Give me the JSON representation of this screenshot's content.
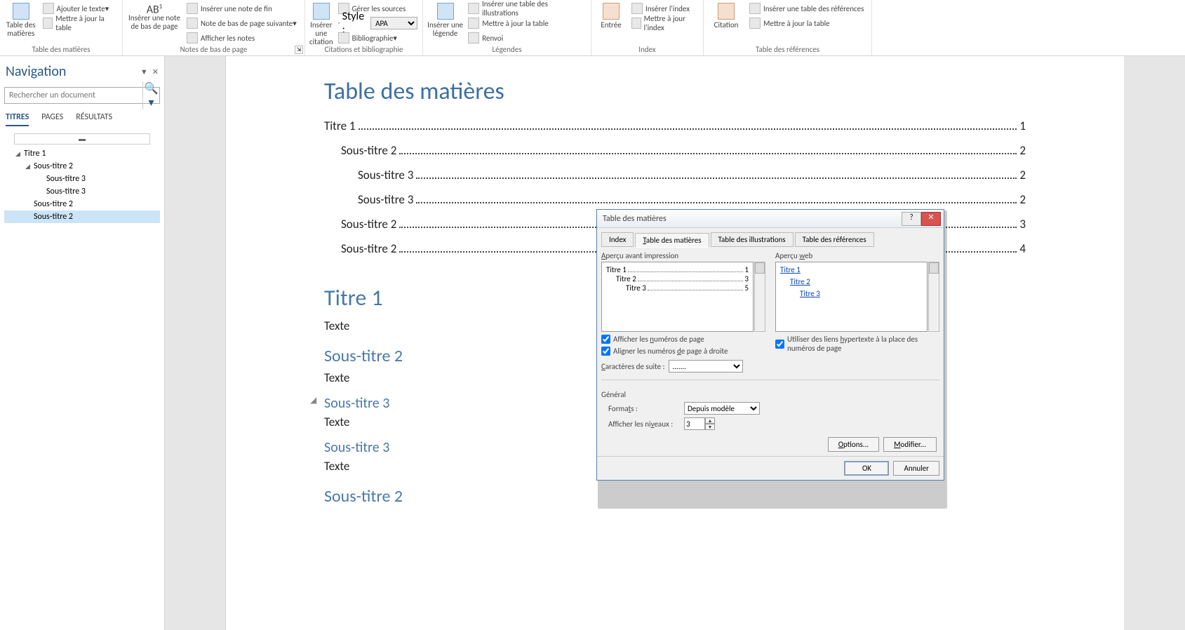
{
  "ribbon": {
    "toc": {
      "label": "Table des matières",
      "main": "Table des matières",
      "add_text": "Ajouter le texte",
      "update": "Mettre à jour la table"
    },
    "footnotes": {
      "label": "Notes de bas de page",
      "main": "Insérer une note de bas de page",
      "ab": "AB",
      "endnote": "Insérer une note de fin",
      "next": "Note de bas de page suivante",
      "show": "Afficher les notes"
    },
    "citations": {
      "label": "Citations et bibliographie",
      "main": "Insérer une citation",
      "manage": "Gérer les sources",
      "style_label": "Style :",
      "style_value": "APA",
      "biblio": "Bibliographie"
    },
    "captions": {
      "label": "Légendes",
      "main": "Insérer une légende",
      "insert_table": "Insérer une table des illustrations",
      "update": "Mettre à jour la table",
      "crossref": "Renvoi"
    },
    "index": {
      "label": "Index",
      "main": "Entrée",
      "insert": "Insérer l'index",
      "update": "Mettre à jour l'index"
    },
    "refs_table": {
      "label": "Table des références",
      "main": "Citation",
      "insert": "Insérer une table des références",
      "update": "Mettre à jour la table"
    }
  },
  "nav": {
    "title": "Navigation",
    "search_placeholder": "Rechercher un document",
    "tabs": [
      "TITRES",
      "PAGES",
      "RÉSULTATS"
    ],
    "tree": [
      {
        "level": 0,
        "label": "Titre 1",
        "tri": "◢"
      },
      {
        "level": 1,
        "label": "Sous-titre 2",
        "tri": "◢"
      },
      {
        "level": 2,
        "label": "Sous-titre 3"
      },
      {
        "level": 2,
        "label": "Sous-titre 3"
      },
      {
        "level": 1,
        "label": "Sous-titre 2"
      },
      {
        "level": 1,
        "label": "Sous-titre 2",
        "selected": true
      }
    ]
  },
  "doc": {
    "toc_heading": "Table des matières",
    "toc": [
      {
        "ind": 0,
        "title": "Titre 1",
        "page": "1"
      },
      {
        "ind": 1,
        "title": "Sous-titre 2",
        "page": "2"
      },
      {
        "ind": 2,
        "title": "Sous-titre 3",
        "page": "2"
      },
      {
        "ind": 2,
        "title": "Sous-titre 3",
        "page": "2"
      },
      {
        "ind": 1,
        "title": "Sous-titre 2",
        "page": "3"
      },
      {
        "ind": 1,
        "title": "Sous-titre 2",
        "page": "4"
      }
    ],
    "content": [
      {
        "type": "h1",
        "text": "Titre 1"
      },
      {
        "type": "p",
        "text": "Texte"
      },
      {
        "type": "h2",
        "text": "Sous-titre 2"
      },
      {
        "type": "p",
        "text": "Texte"
      },
      {
        "type": "h3",
        "text": "Sous-titre 3",
        "collapse": true
      },
      {
        "type": "p",
        "text": "Texte"
      },
      {
        "type": "h3",
        "text": "Sous-titre 3"
      },
      {
        "type": "p",
        "text": "Texte"
      },
      {
        "type": "h2",
        "text": "Sous-titre 2"
      }
    ]
  },
  "dialog": {
    "title": "Table des matières",
    "tabs": [
      "Index",
      "Table des matières",
      "Table des illustrations",
      "Table des références"
    ],
    "active_tab": 1,
    "print_preview_label": "Aperçu avant impression",
    "web_preview_label": "Aperçu web",
    "preview_print": [
      {
        "ind": 0,
        "title": "Titre 1",
        "page": "1"
      },
      {
        "ind": 1,
        "title": "Titre 2",
        "page": "3"
      },
      {
        "ind": 2,
        "title": "Titre 3",
        "page": "5"
      }
    ],
    "preview_web": [
      "Titre 1",
      "Titre 2",
      "Titre 3"
    ],
    "chk_page_numbers": "Afficher les numéros de page",
    "chk_right_align": "Aligner les numéros de page à droite",
    "chk_hyperlinks": "Utiliser des liens hypertexte à la place des numéros de page",
    "leader_label": "Caractères de suite :",
    "leader_value": ".......",
    "general_label": "Général",
    "formats_label": "Formats :",
    "formats_value": "Depuis modèle",
    "levels_label": "Afficher les niveaux :",
    "levels_value": "3",
    "btn_options": "Options...",
    "btn_modify": "Modifier...",
    "btn_ok": "OK",
    "btn_cancel": "Annuler"
  }
}
